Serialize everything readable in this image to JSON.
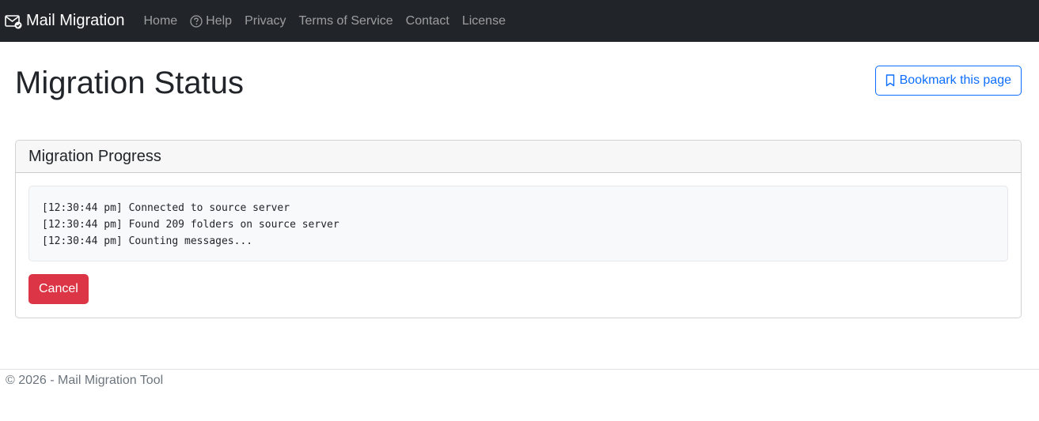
{
  "navbar": {
    "brand": "Mail Migration",
    "brand_icon": "envelope-check-icon",
    "links": [
      {
        "label": "Home"
      },
      {
        "label": "Help",
        "icon": "question-circle-icon"
      },
      {
        "label": "Privacy"
      },
      {
        "label": "Terms of Service"
      },
      {
        "label": "Contact"
      },
      {
        "label": "License"
      }
    ]
  },
  "page": {
    "title": "Migration Status",
    "bookmark_label": "Bookmark this page",
    "bookmark_icon": "bookmark-icon"
  },
  "card": {
    "title": "Migration Progress",
    "log": [
      "[12:30:44 pm] Connected to source server",
      "[12:30:44 pm] Found 209 folders on source server",
      "[12:30:44 pm] Counting messages..."
    ],
    "cancel_label": "Cancel"
  },
  "footer": {
    "text": "© 2026 - Mail Migration Tool"
  },
  "colors": {
    "navbar_bg": "#212529",
    "primary": "#0d6efd",
    "danger": "#dc3545"
  }
}
